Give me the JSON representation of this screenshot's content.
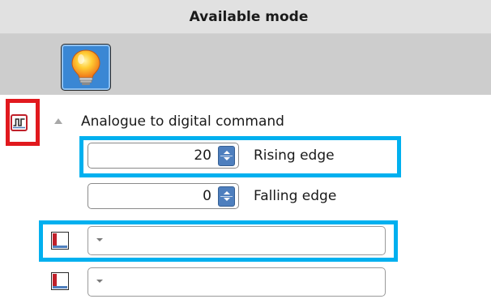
{
  "header": {
    "title": "Available mode"
  },
  "mode_button": {
    "icon": "lightbulb-icon"
  },
  "group": {
    "icon": "digital-signal-icon",
    "toggle_icon": "collapse-arrow-icon",
    "label": "Analogue to digital command"
  },
  "rising": {
    "value": "20",
    "label": "Rising edge"
  },
  "falling": {
    "value": "0",
    "label": "Falling edge"
  },
  "dropdowns": [
    {
      "icon": "link-channel-icon",
      "value": ""
    },
    {
      "icon": "link-channel-icon",
      "value": ""
    }
  ],
  "colors": {
    "header_bg": "#e1e1e1",
    "band_bg": "#cdcdcd",
    "highlight_red": "#e1191e",
    "highlight_blue": "#00b0ef",
    "spin_blue": "#4e7fbe",
    "button_blue": "#3a87d4"
  }
}
